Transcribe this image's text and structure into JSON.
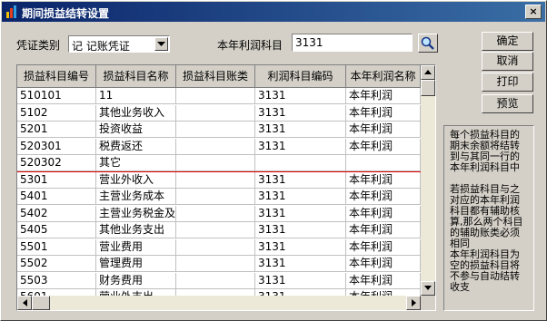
{
  "window": {
    "title": "期间损益结转设置",
    "close_label": "×"
  },
  "form": {
    "voucher_type_label": "凭证类别",
    "voucher_type_value": "记 记账凭证",
    "profit_account_label": "本年利润科目",
    "profit_account_value": "3131"
  },
  "buttons": {
    "ok": "确定",
    "cancel": "取消",
    "print": "打印",
    "preview": "预览"
  },
  "grid": {
    "columns": [
      "损益科目编号",
      "损益科目名称",
      "损益科目账类",
      "利润科目编码",
      "本年利润名称"
    ],
    "rows": [
      [
        "510101",
        "11",
        "",
        "3131",
        "本年利润"
      ],
      [
        "5102",
        "其他业务收入",
        "",
        "3131",
        "本年利润"
      ],
      [
        "5201",
        "投资收益",
        "",
        "3131",
        "本年利润"
      ],
      [
        "520301",
        "税费返还",
        "",
        "3131",
        "本年利润"
      ],
      [
        "520302",
        "其它",
        "",
        "",
        ""
      ],
      [
        "5301",
        "营业外收入",
        "",
        "3131",
        "本年利润"
      ],
      [
        "5401",
        "主营业务成本",
        "",
        "3131",
        "本年利润"
      ],
      [
        "5402",
        "主营业务税金及",
        "",
        "3131",
        "本年利润"
      ],
      [
        "5405",
        "其他业务支出",
        "",
        "3131",
        "本年利润"
      ],
      [
        "5501",
        "营业费用",
        "",
        "3131",
        "本年利润"
      ],
      [
        "5502",
        "管理费用",
        "",
        "3131",
        "本年利润"
      ],
      [
        "5503",
        "财务费用",
        "",
        "3131",
        "本年利润"
      ],
      [
        "5601",
        "营业外支出",
        "",
        "3131",
        "本年利润"
      ]
    ]
  },
  "note": {
    "para1": "每个损益科目的期末余额将结转到与其同一行的本年利润科目中",
    "para2": "若损益科目与之对应的本年利润科目都有辅助核算,那么两个科目的辅助账类必须相同",
    "para3": "本年利润科目为空的损益科目将不参与自动结转收支"
  },
  "icons": {
    "app": "app-icon",
    "close": "close-icon",
    "dropdown": "chevron-down-icon",
    "search": "search-icon",
    "scroll_up": "arrow-up-icon",
    "scroll_down": "arrow-down-icon",
    "scroll_left": "arrow-left-icon",
    "scroll_right": "arrow-right-icon"
  }
}
